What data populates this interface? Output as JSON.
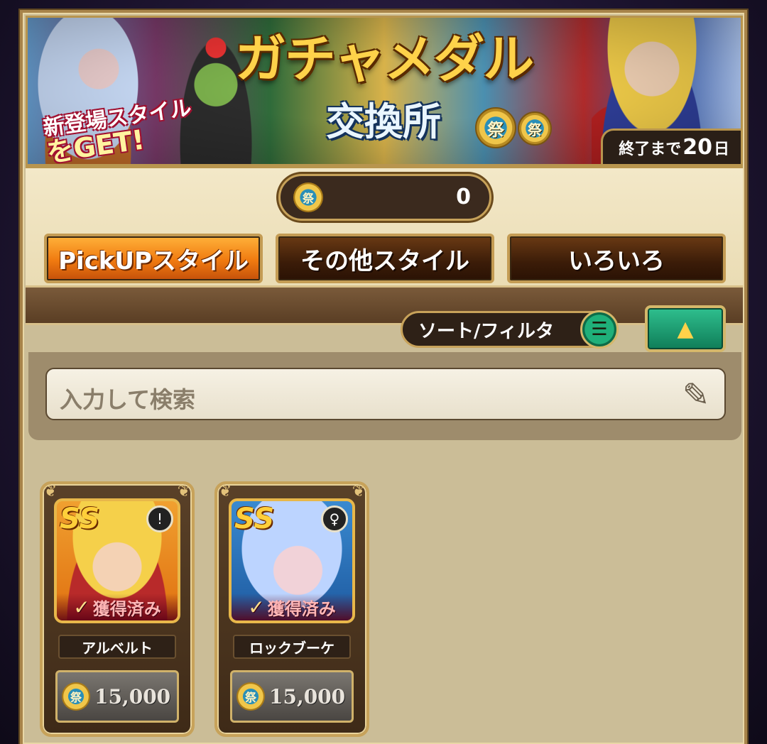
{
  "banner": {
    "title": "ガチャメダル",
    "subtitle": "交換所",
    "tag_line1": "新登場スタイル",
    "tag_line2": "をGET!",
    "medal_symbol": "祭",
    "end_label": "終了まで",
    "end_days": "20",
    "end_unit": "日"
  },
  "currency": {
    "icon": "medal-icon",
    "value": "0"
  },
  "tabs": [
    {
      "label": "PickUPスタイル",
      "active": true
    },
    {
      "label": "その他スタイル",
      "active": false
    },
    {
      "label": "いろいろ",
      "active": false
    }
  ],
  "toolbar": {
    "sort_filter_label": "ソート/フィルタ",
    "sort_icon": "menu-icon",
    "collapse_icon": "triangle-up-icon"
  },
  "search": {
    "placeholder": "入力して検索",
    "icon": "edit-icon"
  },
  "items": [
    {
      "rank": "SS",
      "role_icon": "sword-icon",
      "status": "獲得済み",
      "name": "アルベルト",
      "price": "15,000",
      "coin_symbol": "祭"
    },
    {
      "rank": "SS",
      "role_icon": "staff-icon",
      "status": "獲得済み",
      "name": "ロックブーケ",
      "price": "15,000",
      "coin_symbol": "祭"
    }
  ],
  "colors": {
    "accent_orange": "#f07a10",
    "accent_green": "#1fb07a",
    "gold": "#c7a25a"
  }
}
